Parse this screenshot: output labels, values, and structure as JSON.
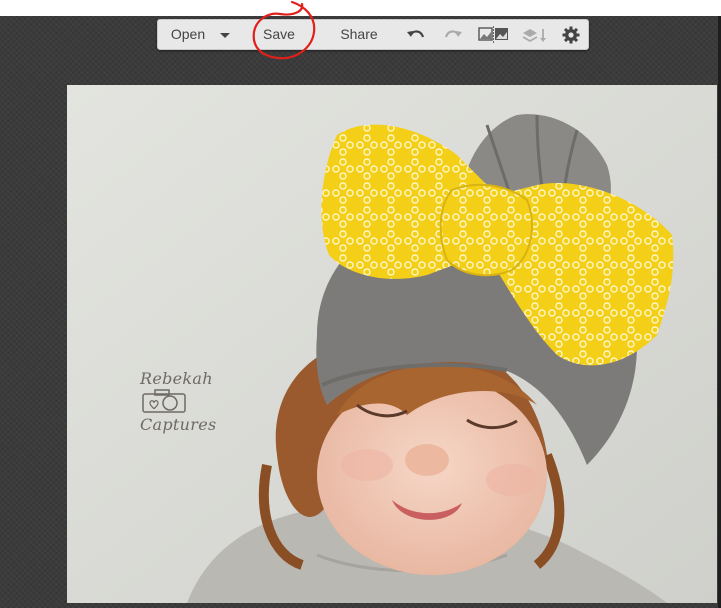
{
  "toolbar": {
    "open_label": "Open",
    "save_label": "Save",
    "share_label": "Share",
    "icons": [
      "chevron-down-icon",
      "undo-icon",
      "redo-icon",
      "compare-icon",
      "layers-icon",
      "gear-icon"
    ]
  },
  "photo": {
    "watermark_left": "Rebekah",
    "watermark_right": "Captures"
  },
  "colors": {
    "toolbar_bg": "#e8e8e8",
    "annotation": "#e0201a",
    "workspace": "#3b3b3b",
    "bow": "#f6d21c"
  }
}
